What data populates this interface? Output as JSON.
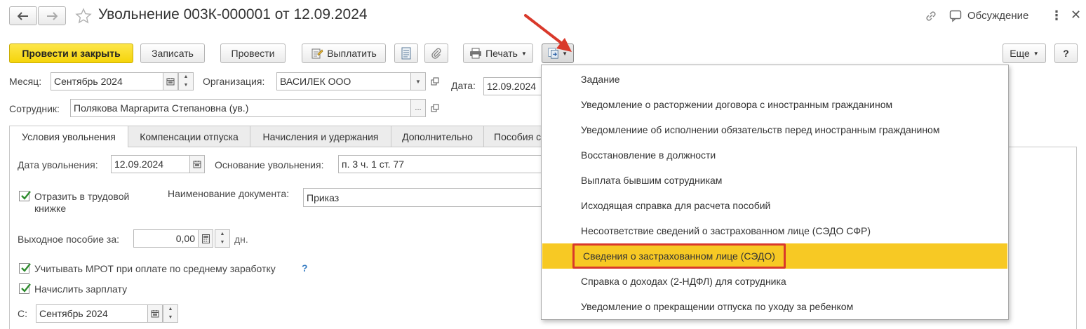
{
  "window": {
    "title": "Увольнение 003К-000001 от 12.09.2024",
    "discussion_label": "Обсуждение"
  },
  "toolbar": {
    "post_close": "Провести и закрыть",
    "save": "Записать",
    "post": "Провести",
    "pay": "Выплатить",
    "print": "Печать",
    "more": "Еще",
    "help": "?"
  },
  "header": {
    "month_label": "Месяц:",
    "month_value": "Сентябрь 2024",
    "org_label": "Организация:",
    "org_value": "ВАСИЛЕК ООО",
    "date_label": "Дата:",
    "date_value": "12.09.2024",
    "employee_label": "Сотрудник:",
    "employee_value": "Полякова Маргарита Степановна (ув.)"
  },
  "tabs": [
    {
      "label": "Условия увольнения"
    },
    {
      "label": "Компенсации отпуска"
    },
    {
      "label": "Начисления и удержания"
    },
    {
      "label": "Дополнительно"
    },
    {
      "label": "Пособия с"
    }
  ],
  "conditions": {
    "dismissal_date_label": "Дата увольнения:",
    "dismissal_date_value": "12.09.2024",
    "basis_label": "Основание увольнения:",
    "basis_value": "п. 3 ч. 1 ст. 77",
    "labor_book_label_line1": "Отразить в трудовой",
    "labor_book_label_line2": "книжке",
    "doc_name_label": "Наименование документа:",
    "doc_name_value": "Приказ",
    "severance_label": "Выходное пособие за:",
    "severance_value": "0,00",
    "severance_unit": "дн.",
    "mrot_label": "Учитывать МРОТ при оплате по среднему заработку",
    "mrot_help": "?",
    "salary_label": "Начислить зарплату",
    "from_label": "С:",
    "from_value": "Сентябрь 2024"
  },
  "dropdown_menu": {
    "items": [
      {
        "label": "Задание"
      },
      {
        "label": "Уведомление о расторжении договора с иностранным гражданином"
      },
      {
        "label": "Уведомлениие об исполнении обязательств перед иностранным гражданином"
      },
      {
        "label": "Восстановление в должности"
      },
      {
        "label": "Выплата бывшим сотрудникам"
      },
      {
        "label": "Исходящая справка для расчета пособий"
      },
      {
        "label": "Несоответствие сведений о застрахованном лице (СЭДО СФР)"
      },
      {
        "label": "Сведения о застрахованном лице (СЭДО)"
      },
      {
        "label": "Справка о доходах (2-НДФЛ) для сотрудника"
      },
      {
        "label": "Уведомление о прекращении отпуска по уходу за ребенком"
      }
    ],
    "highlighted_index": 7
  },
  "colors": {
    "primary_button": "#f5d40a",
    "highlight": "#f7c924",
    "annotation_red": "#d9392b"
  }
}
